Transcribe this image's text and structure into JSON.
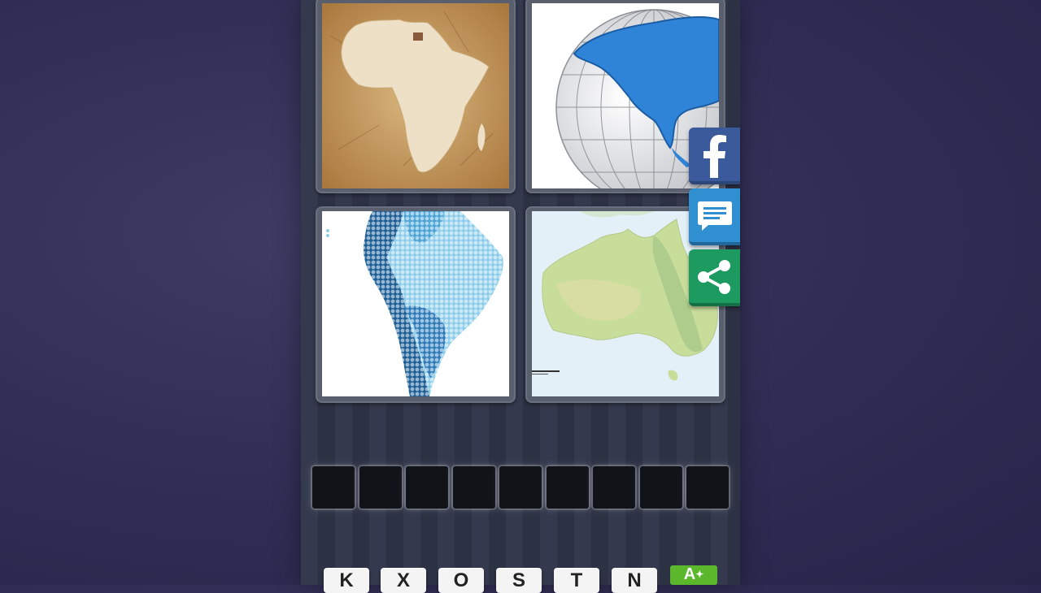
{
  "puzzle": {
    "pictures": [
      {
        "name": "africa-map-picture"
      },
      {
        "name": "globe-north-america-picture"
      },
      {
        "name": "south-america-dots-picture"
      },
      {
        "name": "australia-map-picture"
      }
    ],
    "answer_slot_count": 9,
    "letter_keys": [
      "K",
      "X",
      "O",
      "S",
      "T",
      "N"
    ]
  },
  "social": {
    "facebook_icon": "facebook-icon",
    "message_icon": "message-icon",
    "share_icon": "share-icon"
  },
  "hint_button": {
    "label": "A"
  },
  "colors": {
    "facebook": "#3b5a9b",
    "message": "#2f8fd0",
    "share": "#1d9a5f",
    "hint": "#5bb72c"
  }
}
